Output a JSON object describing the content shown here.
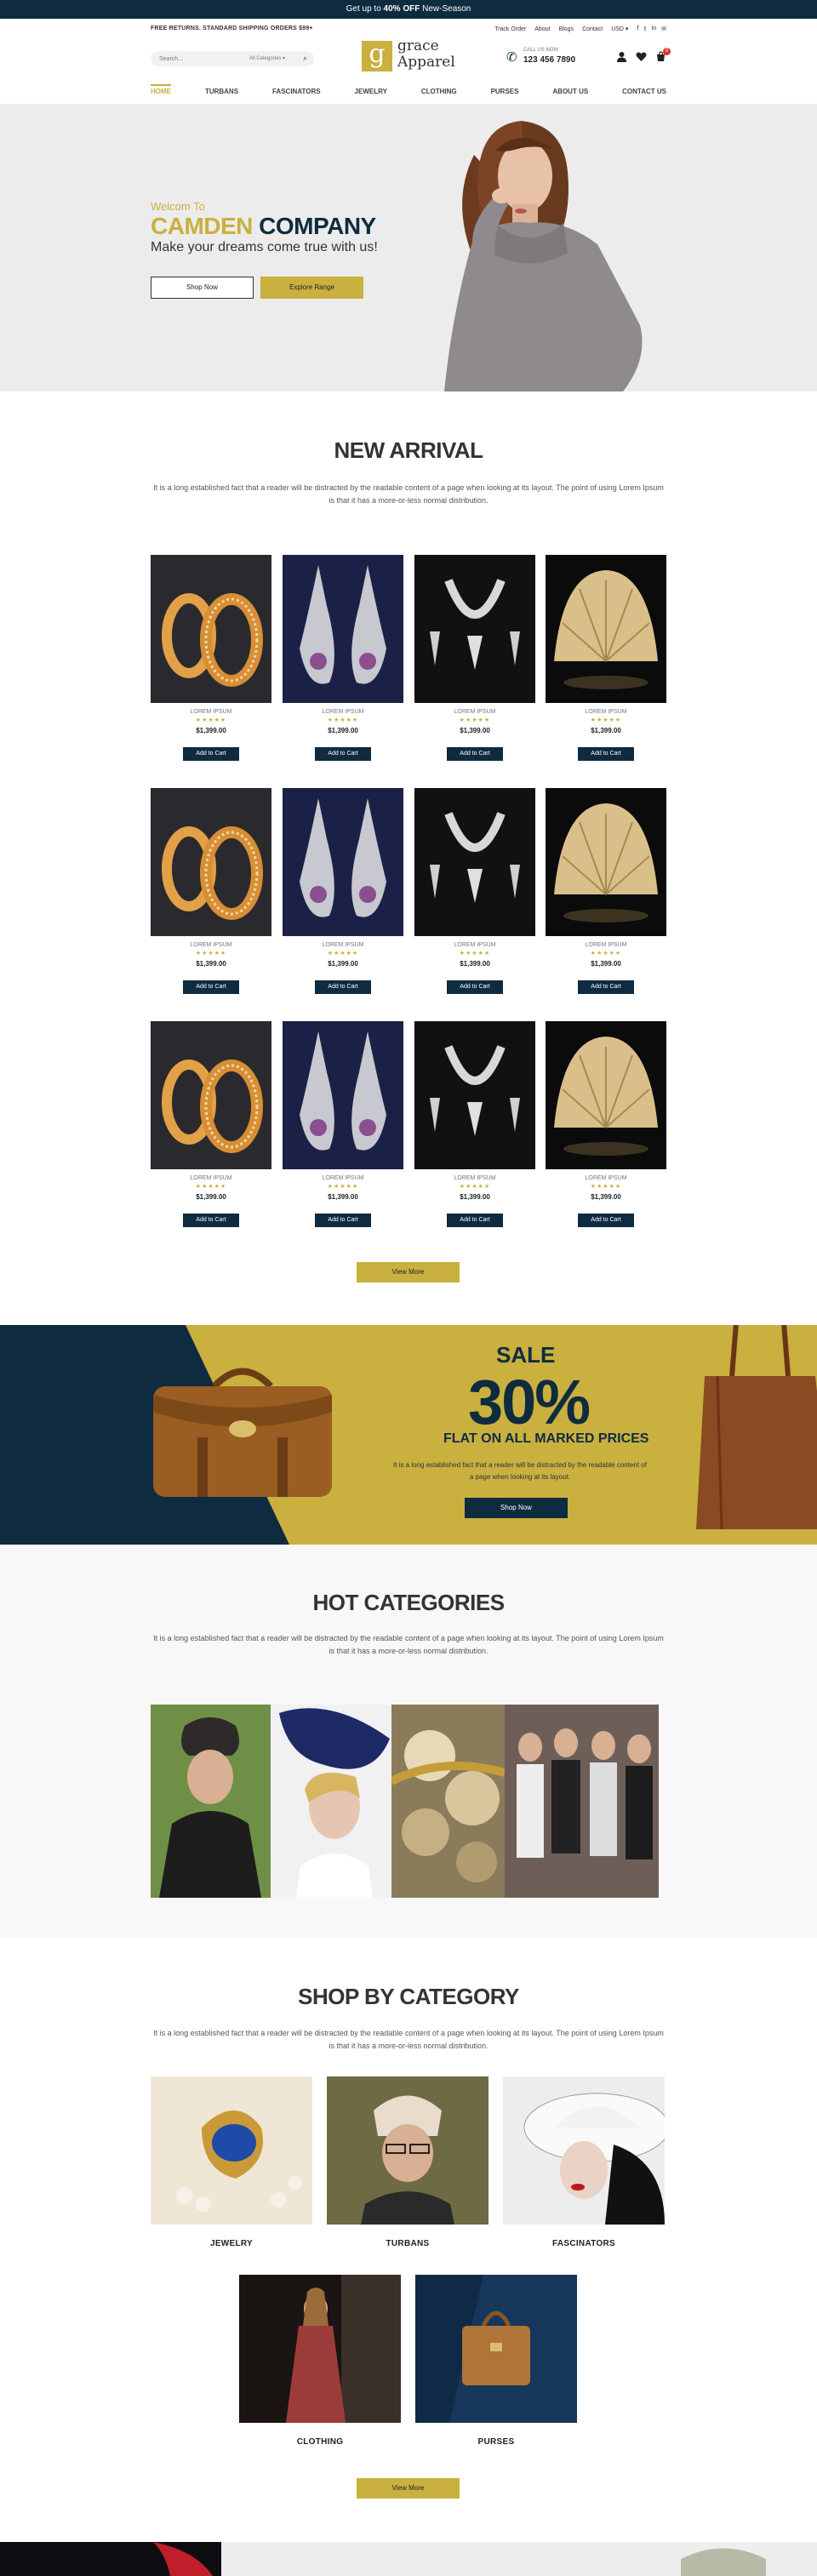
{
  "promo": {
    "prefix": "Get up to ",
    "highlight": "40% OFF",
    "suffix": " New-Season"
  },
  "utility": {
    "shipping": "FREE RETURNS. STANDARD SHIPPING ORDERS $99+",
    "links": [
      "Track Order",
      "About",
      "Blogs",
      "Contact"
    ],
    "currency": "USD"
  },
  "search": {
    "placeholder": "Search...",
    "category": "All Categories"
  },
  "logo": {
    "letter": "g",
    "line1": "grace",
    "line2": "Apparel"
  },
  "phone": {
    "label": "CALL US NOW",
    "number": "123 456 7890"
  },
  "cart": {
    "count": "0"
  },
  "nav": [
    "HOME",
    "TURBANS",
    "FASCINATORS",
    "JEWELRY",
    "CLOTHING",
    "PURSES",
    "ABOUT US",
    "CONTACT US"
  ],
  "hero": {
    "welcome": "Welcom To",
    "company_a": "CAMDEN",
    "company_b": " COMPANY",
    "tagline": "Make your dreams come true with us!",
    "btn_shop": "Shop Now",
    "btn_explore": "Explore Range"
  },
  "new_arrival": {
    "title": "NEW ARRIVAL",
    "desc": "It is a long established fact that a reader will be distracted by the readable content of a page when looking at its layout. The point of using Lorem Ipsum is that it has a more-or-less normal distribution.",
    "product_name": "LOREM IPSUM",
    "stars": "★★★★★",
    "price": "$1,399.00",
    "add_to_cart": "Add to Cart",
    "view_more": "View More"
  },
  "sale": {
    "label": "SALE",
    "percent": "30%",
    "flat": "FLAT ON ALL MARKED PRICES",
    "desc": "It is a long established fact that a reader will be distracted by the readable content of a page when looking at its layout.",
    "btn": "Shop Now"
  },
  "hot": {
    "title": "HOT CATEGORIES",
    "desc": "It is a long established fact that a reader will be distracted by the readable content of a page when looking at its layout. The point of using Lorem Ipsum is that it has a more-or-less normal distribution."
  },
  "shop_by": {
    "title": "SHOP BY CATEGORY",
    "desc": "It is a long established fact that a reader will be distracted by the readable content of a page when looking at its layout. The point of using Lorem Ipsum is that it has a more-or-less normal distribution.",
    "categories": [
      "JEWELRY",
      "TURBANS",
      "FASCINATORS",
      "CLOTHING",
      "PURSES"
    ],
    "view_more": "View More"
  },
  "colors": {
    "navy": "#0e2b40",
    "gold": "#c9b03f"
  }
}
